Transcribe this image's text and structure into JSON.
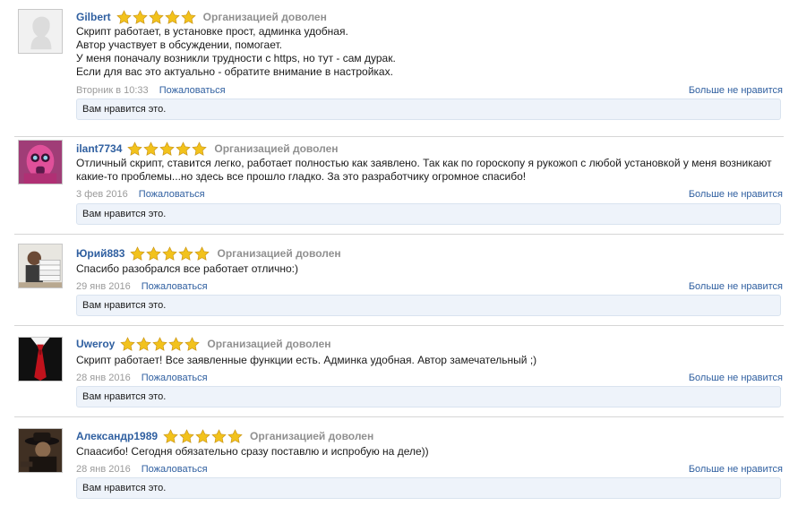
{
  "reviews": [
    {
      "username": "Gilbert",
      "rating_label": "Организацией доволен",
      "stars": 5,
      "lines": [
        "Скрипт работает, в установке прост, админка удобная.",
        "Автор участвует в обсуждении, помогает.",
        "У меня поначалу возникли трудности с https, но тут - сам дурак.",
        "Если для вас это актуально - обратите внимание в настройках."
      ],
      "date": "Вторник в 10:33",
      "report_label": "Пожаловаться",
      "unlike_label": "Больше не нравится",
      "likes_text": "Вам нравится это."
    },
    {
      "username": "ilant7734",
      "rating_label": "Организацией доволен",
      "stars": 5,
      "lines": [
        "Отличный скрипт, ставится легко, работает полностью как заявлено. Так как по гороскопу я рукожоп с любой установкой у меня возникают",
        "какие-то проблемы...но здесь все прошло гладко. За это разработчику огромное спасибо!"
      ],
      "date": "3 фев 2016",
      "report_label": "Пожаловаться",
      "unlike_label": "Больше не нравится",
      "likes_text": "Вам нравится это."
    },
    {
      "username": "Юрий883",
      "rating_label": "Организацией доволен",
      "stars": 5,
      "lines": [
        "Спасибо разобрался все работает отлично:)"
      ],
      "date": "29 янв 2016",
      "report_label": "Пожаловаться",
      "unlike_label": "Больше не нравится",
      "likes_text": "Вам нравится это."
    },
    {
      "username": "Uweroy",
      "rating_label": "Организацией доволен",
      "stars": 5,
      "lines": [
        "Скрипт работает! Все заявленные функции есть. Админка удобная. Автор замечательный ;)"
      ],
      "date": "28 янв 2016",
      "report_label": "Пожаловаться",
      "unlike_label": "Больше не нравится",
      "likes_text": "Вам нравится это."
    },
    {
      "username": "Александр1989",
      "rating_label": "Организацией доволен",
      "stars": 5,
      "lines": [
        "Спаасибо! Сегодня обязательно сразу поставлю и испробую на деле))"
      ],
      "date": "28 янв 2016",
      "report_label": "Пожаловаться",
      "unlike_label": "Больше не нравится",
      "likes_text": "Вам нравится это."
    }
  ],
  "colors": {
    "link": "#2f5fa0",
    "muted": "#909090",
    "likebox_bg": "#eef3fa",
    "star": "#f2c21c"
  }
}
